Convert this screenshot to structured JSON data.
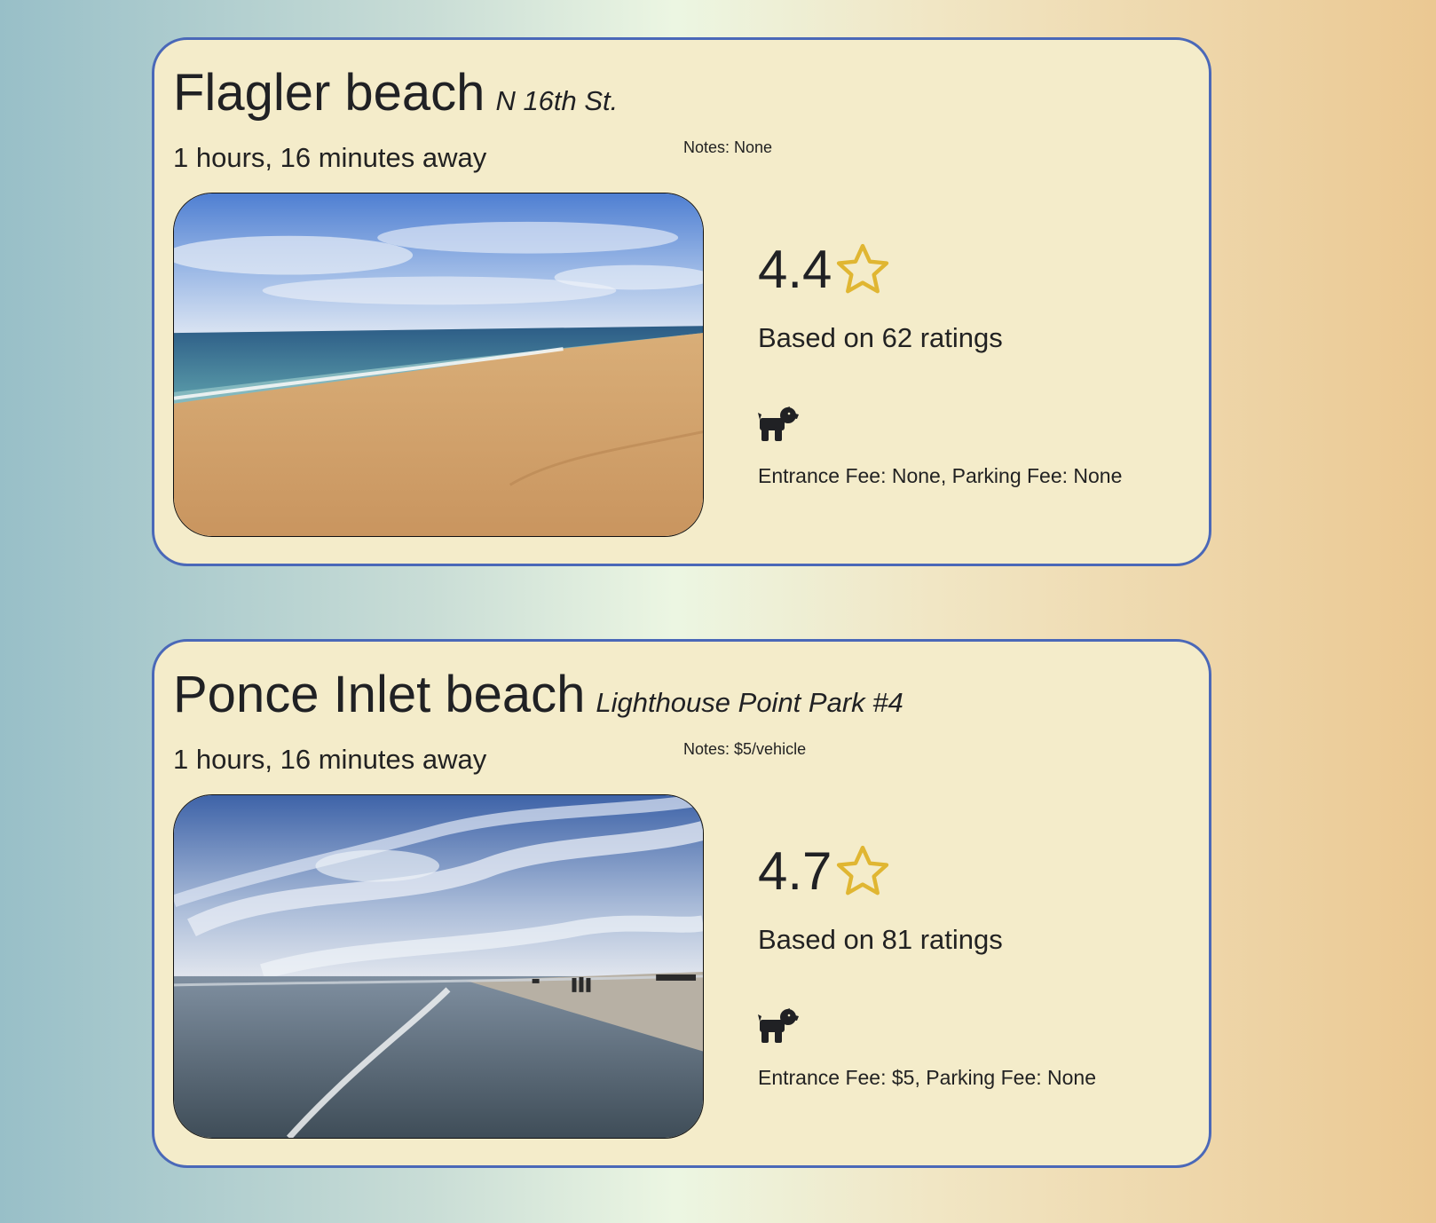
{
  "colors": {
    "card_background": "#f4ecca",
    "card_border": "#4a68b8",
    "star": "#e0b632",
    "text": "#202124"
  },
  "beaches": [
    {
      "name": "Flagler beach",
      "location": "N 16th St.",
      "distance": "1 hours, 16 minutes away",
      "notes": "Notes: None",
      "rating": "4.4",
      "based_on": "Based on 62 ratings",
      "dog_friendly_icon": "dog-icon",
      "fees": "Entrance Fee: None, Parking Fee: None",
      "photo": "beach-photo"
    },
    {
      "name": "Ponce Inlet beach",
      "location": "Lighthouse Point Park #4",
      "distance": "1 hours, 16 minutes away",
      "notes": "Notes: $5/vehicle",
      "rating": "4.7",
      "based_on": "Based on 81 ratings",
      "dog_friendly_icon": "dog-icon",
      "fees": "Entrance Fee: $5, Parking Fee: None",
      "photo": "beach-photo"
    }
  ]
}
